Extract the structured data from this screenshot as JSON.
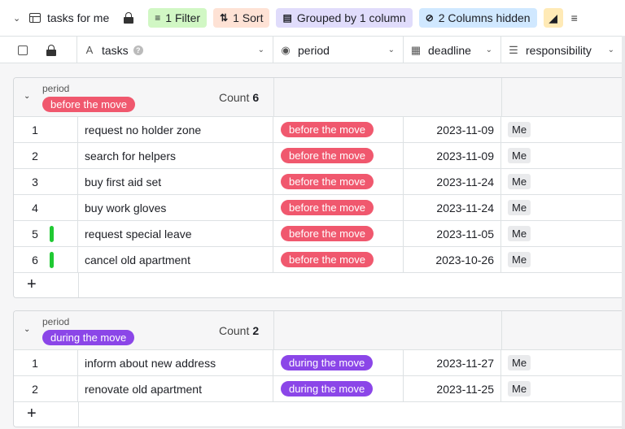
{
  "toolbar": {
    "view_name": "tasks for me",
    "filter_label": "1 Filter",
    "sort_label": "1 Sort",
    "group_label": "Grouped by 1 column",
    "hidden_label": "2 Columns hidden",
    "filter_color": "#d1f7c4",
    "sort_color": "#fee2d5",
    "group_color": "#e0dcfb",
    "hidden_color": "#d0e8ff"
  },
  "columns": {
    "tasks": "tasks",
    "period": "period",
    "deadline": "deadline",
    "responsibility": "responsibility"
  },
  "groups": [
    {
      "field": "period",
      "tag": "before the move",
      "tag_color": "#f0586e",
      "count_label": "Count",
      "count": "6",
      "rows": [
        {
          "num": "1",
          "task": "request no holder zone",
          "period": "before the move",
          "deadline": "2023-11-09",
          "resp": "Me",
          "flag": false
        },
        {
          "num": "2",
          "task": "search for helpers",
          "period": "before the move",
          "deadline": "2023-11-09",
          "resp": "Me",
          "flag": false
        },
        {
          "num": "3",
          "task": "buy first aid set",
          "period": "before the move",
          "deadline": "2023-11-24",
          "resp": "Me",
          "flag": false
        },
        {
          "num": "4",
          "task": "buy work gloves",
          "period": "before the move",
          "deadline": "2023-11-24",
          "resp": "Me",
          "flag": false
        },
        {
          "num": "5",
          "task": "request special leave",
          "period": "before the move",
          "deadline": "2023-11-05",
          "resp": "Me",
          "flag": true
        },
        {
          "num": "6",
          "task": "cancel old apartment",
          "period": "before the move",
          "deadline": "2023-10-26",
          "resp": "Me",
          "flag": true
        }
      ]
    },
    {
      "field": "period",
      "tag": "during the move",
      "tag_color": "#8b46e8",
      "count_label": "Count",
      "count": "2",
      "rows": [
        {
          "num": "1",
          "task": "inform about new address",
          "period": "during the move",
          "deadline": "2023-11-27",
          "resp": "Me",
          "flag": false
        },
        {
          "num": "2",
          "task": "renovate old apartment",
          "period": "during the move",
          "deadline": "2023-11-25",
          "resp": "Me",
          "flag": false
        }
      ]
    }
  ]
}
